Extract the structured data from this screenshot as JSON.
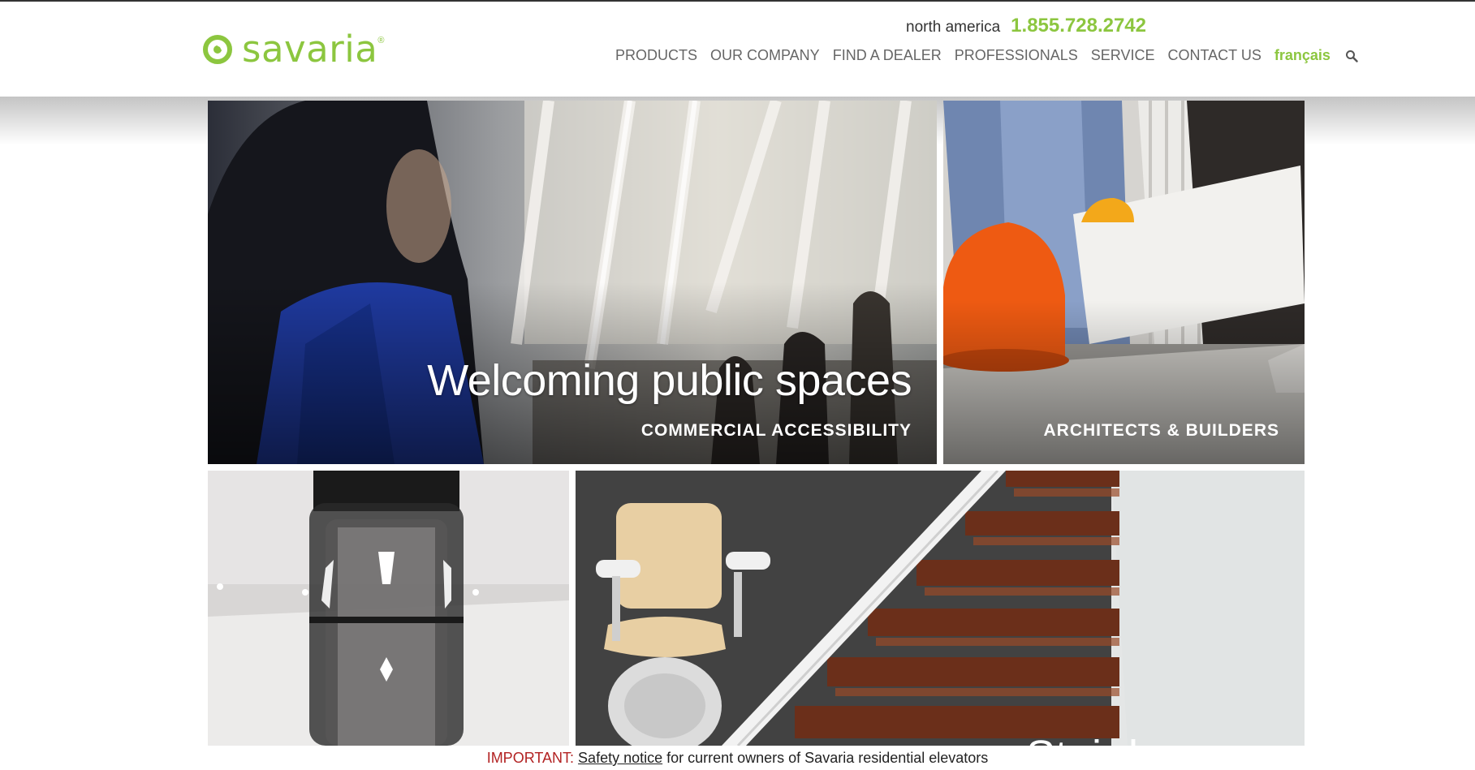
{
  "brand": {
    "name": "savaria",
    "reg_mark": "®",
    "accent_color": "#8cc63f"
  },
  "header": {
    "region": "north america",
    "phone": "1.855.728.2742"
  },
  "nav": {
    "items": [
      {
        "label": "PRODUCTS"
      },
      {
        "label": "OUR COMPANY"
      },
      {
        "label": "FIND A DEALER"
      },
      {
        "label": "PROFESSIONALS"
      },
      {
        "label": "SERVICE"
      },
      {
        "label": "CONTACT US"
      }
    ],
    "language": "français",
    "search_icon": "search-icon"
  },
  "tiles": {
    "commercial": {
      "title": "Welcoming public spaces",
      "subtitle": "COMMERCIAL ACCESSIBILITY"
    },
    "architects": {
      "subtitle": "ARCHITECTS & BUILDERS"
    },
    "elevator": {},
    "stairlift": {
      "partial_title": "Stair   l"
    }
  },
  "notice": {
    "flag": "IMPORTANT:",
    "link": "Safety notice",
    "text": " for current owners of Savaria residential elevators"
  }
}
